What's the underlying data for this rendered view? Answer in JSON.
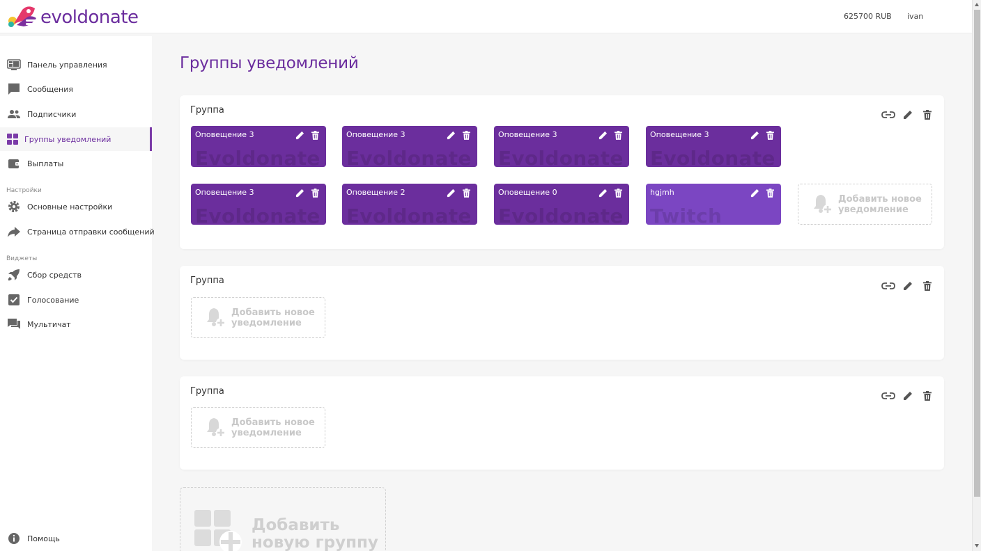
{
  "header": {
    "logo_text": "evoldonate",
    "balance": "625700 RUB",
    "username": "ivan"
  },
  "sidebar": {
    "items": [
      {
        "label": "Панель управления",
        "icon": "dashboard-icon"
      },
      {
        "label": "Сообщения",
        "icon": "chat-icon"
      },
      {
        "label": "Подписчики",
        "icon": "people-icon"
      },
      {
        "label": "Группы уведомлений",
        "icon": "grid-icon",
        "active": true
      },
      {
        "label": "Выплаты",
        "icon": "wallet-icon"
      }
    ],
    "settings_section": "Настройки",
    "settings_items": [
      {
        "label": "Основные настройки",
        "icon": "gear-icon"
      },
      {
        "label": "Страница отправки сообщений",
        "icon": "share-icon"
      }
    ],
    "widgets_section": "Виджеты",
    "widget_items": [
      {
        "label": "Сбор средств",
        "icon": "rocket-icon"
      },
      {
        "label": "Голосование",
        "icon": "checkbox-icon"
      },
      {
        "label": "Мультичат",
        "icon": "forum-icon"
      }
    ],
    "help": {
      "label": "Помощь",
      "icon": "info-icon"
    }
  },
  "main": {
    "title": "Группы уведомлений",
    "groups": [
      {
        "title": "Группа",
        "cards": [
          {
            "name": "Оповещение 3",
            "watermark": "Evoldonate"
          },
          {
            "name": "Оповещение 3",
            "watermark": "Evoldonate"
          },
          {
            "name": "Оповещение 3",
            "watermark": "Evoldonate"
          },
          {
            "name": "Оповещение 3",
            "watermark": "Evoldonate"
          },
          {
            "name": "Оповещение 3",
            "watermark": "Evoldonate"
          },
          {
            "name": "Оповещение 2",
            "watermark": "Evoldonate"
          },
          {
            "name": "Оповещение 0",
            "watermark": "Evoldonate"
          },
          {
            "name": "hgjmh",
            "watermark": "Twitch"
          }
        ],
        "add_label": "Добавить новое уведомление"
      },
      {
        "title": "Группа",
        "cards": [],
        "add_label": "Добавить новое уведомление"
      },
      {
        "title": "Группа",
        "cards": [],
        "add_label": "Добавить новое уведомление"
      }
    ],
    "add_group_label": "Добавить новую группу"
  },
  "colors": {
    "brand": "#6b2d9e",
    "card": "#6b2e9d",
    "card_twitch": "#7b46c2"
  }
}
